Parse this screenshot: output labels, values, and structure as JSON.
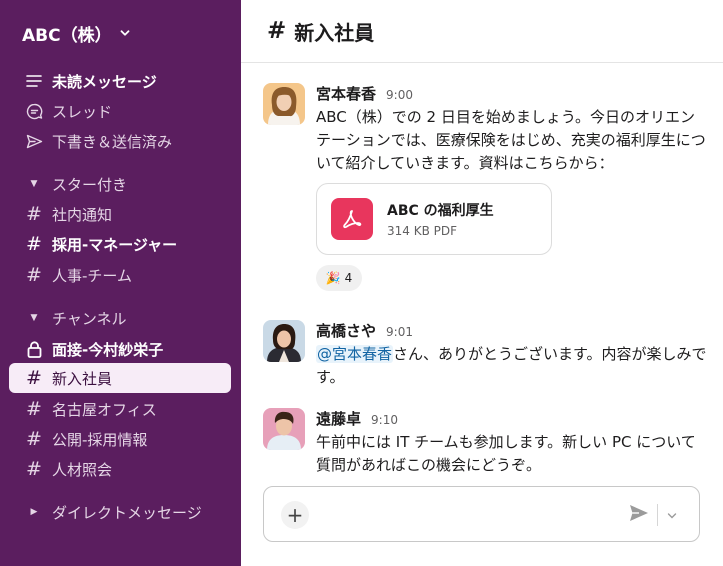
{
  "sidebar": {
    "workspace_name": "ABC（株）",
    "top_items": [
      {
        "label": "未読メッセージ",
        "icon": "unreads-icon"
      },
      {
        "label": "スレッド",
        "icon": "threads-icon"
      },
      {
        "label": "下書き＆送信済み",
        "icon": "send-icon"
      }
    ],
    "starred_section": "スター付き",
    "starred": [
      {
        "label": "社内通知"
      },
      {
        "label": "採用-マネージャー"
      },
      {
        "label": "人事-チーム"
      }
    ],
    "channels_section": "チャンネル",
    "channels": [
      {
        "label": "面接-今村紗栄子"
      },
      {
        "label": "新入社員"
      },
      {
        "label": "名古屋オフィス"
      },
      {
        "label": "公開-採用情報"
      },
      {
        "label": "人材照会"
      }
    ],
    "dm_section": "ダイレクトメッセージ"
  },
  "channel": {
    "hash": "#",
    "title": "新入社員"
  },
  "messages": [
    {
      "sender": "宮本春香",
      "time": "9:00",
      "text": "ABC（株）での 2 日目を始めましょう。今日のオリエンテーションでは、医療保険をはじめ、充実の福利厚生について紹介していきます。資料はこちらから：",
      "file": {
        "name": "ABC の福利厚生",
        "meta": "314 KB PDF"
      },
      "reaction": {
        "emoji": "🎉",
        "count": "4"
      }
    },
    {
      "sender": "高橋さや",
      "time": "9:01",
      "mention": "@宮本春香",
      "text": "さん、ありがとうございます。内容が楽しみです。"
    },
    {
      "sender": "遠藤卓",
      "time": "9:10",
      "text": "午前中には IT チームも参加します。新しい PC について質問があればこの機会にどうぞ。"
    }
  ],
  "composer": {
    "plus": "+"
  },
  "colors": {
    "sidebar_bg": "#5b1e5f",
    "active_item_bg": "#f7ecf7",
    "mention": "#1264a3",
    "pdf_red": "#e8365d"
  }
}
